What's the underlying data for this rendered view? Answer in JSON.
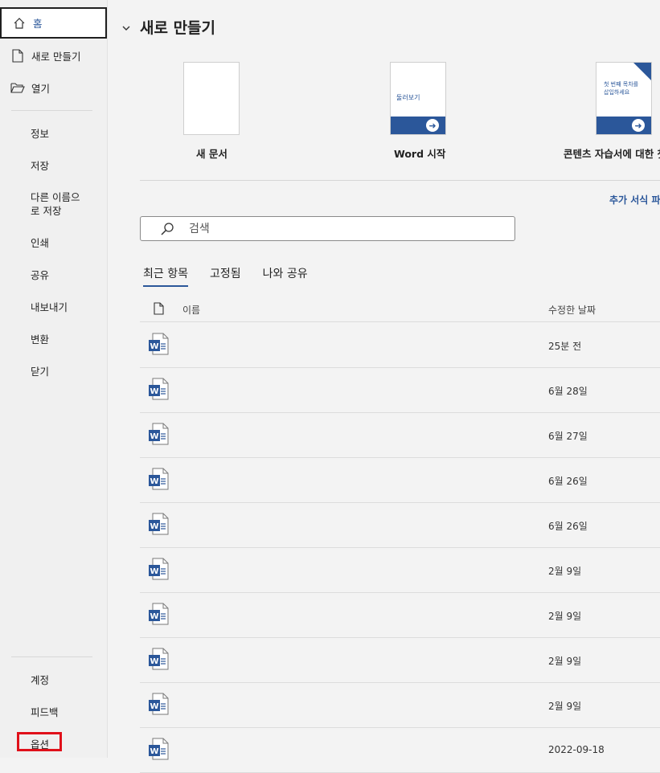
{
  "sidebar": {
    "home": "홈",
    "new": "새로 만들기",
    "open": "열기",
    "items": [
      "정보",
      "저장",
      "다른 이름으로 저장",
      "인쇄",
      "공유",
      "내보내기",
      "변환",
      "닫기"
    ],
    "bottom": [
      "계정",
      "피드백",
      "옵션"
    ],
    "highlight_color": "#e0101a"
  },
  "main": {
    "section_title": "새로 만들기",
    "templates": [
      {
        "caption": "새 문서"
      },
      {
        "caption": "Word 시작",
        "thumb_text": "둘러보기"
      },
      {
        "caption": "콘텐츠 자습서에 대한 첫",
        "thumb_text": "첫 번째 목차를 삽입하세요"
      }
    ],
    "more_link": "추가 서식 파",
    "search_placeholder": "검색",
    "tabs": [
      "최근 항목",
      "고정됨",
      "나와 공유"
    ],
    "columns": {
      "name": "이름",
      "date": "수정한 날짜"
    },
    "files": [
      {
        "date": "25분 전"
      },
      {
        "date": "6월 28일"
      },
      {
        "date": "6월 27일"
      },
      {
        "date": "6월 26일"
      },
      {
        "date": "6월 26일"
      },
      {
        "date": "2월 9일"
      },
      {
        "date": "2월 9일"
      },
      {
        "date": "2월 9일"
      },
      {
        "date": "2월 9일"
      },
      {
        "date": "2022-09-18"
      }
    ],
    "accent_color": "#2b579a"
  }
}
